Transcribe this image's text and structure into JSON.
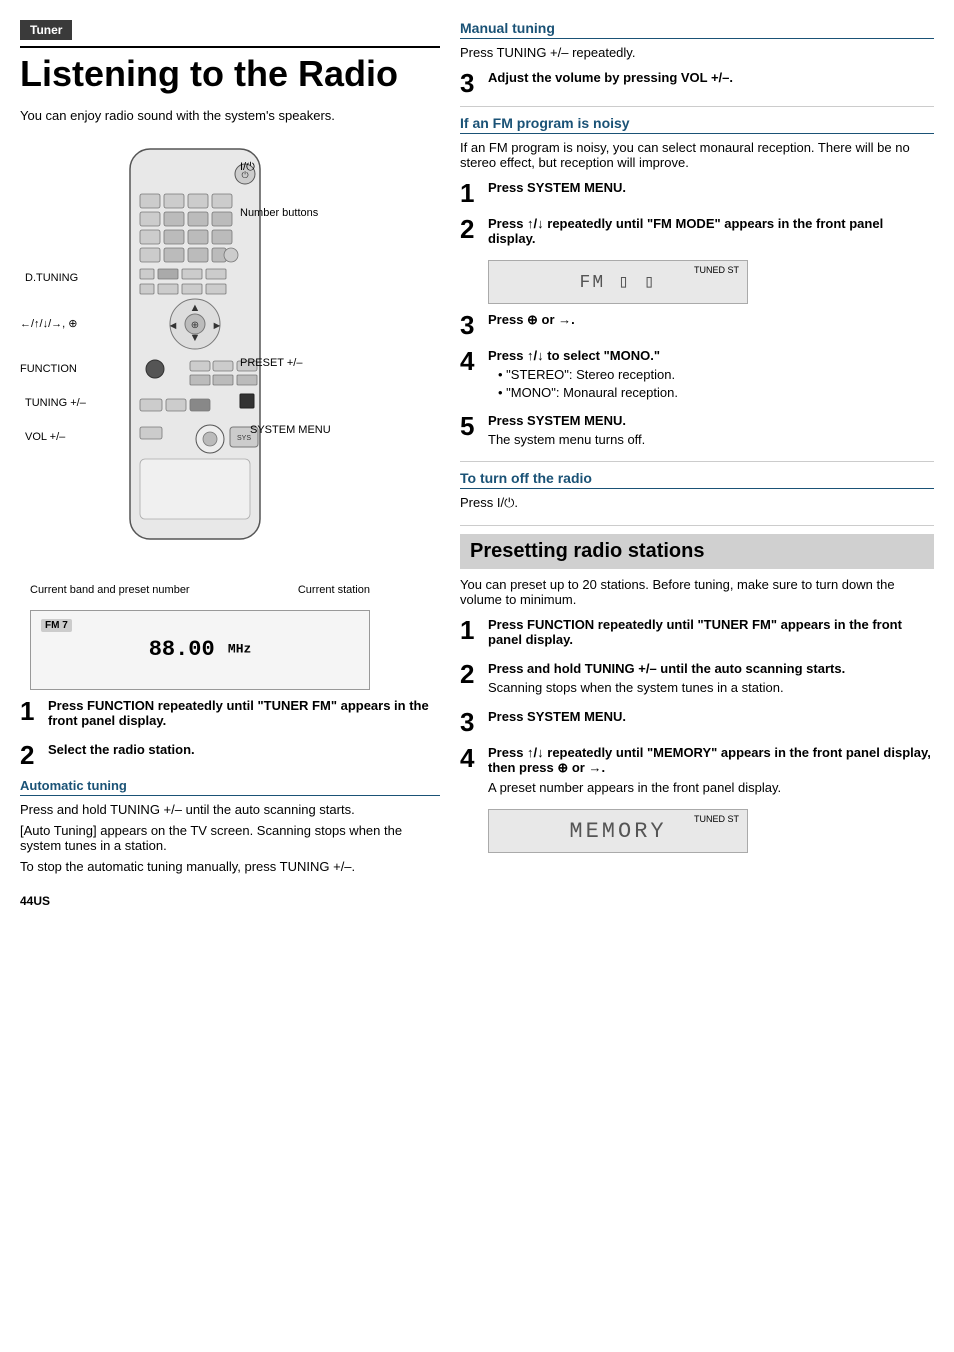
{
  "left": {
    "badge": "Tuner",
    "title": "Listening to the Radio",
    "intro": "You can enjoy radio sound with the system's speakers.",
    "labels": {
      "power": "I/⏻",
      "number_buttons": "Number buttons",
      "d_tuning": "D.TUNING",
      "arrows": "←/↑/↓/→, ⊕",
      "function": "FUNCTION",
      "preset": "PRESET +/–",
      "tuning": "TUNING +/–",
      "vol": "VOL +/–",
      "system_menu": "SYSTEM MENU",
      "current_station": "Current station",
      "current_band": "Current band and preset number"
    },
    "display": {
      "band": "FM 7",
      "freq": "88.00",
      "unit": "MHz"
    },
    "steps": [
      {
        "num": "1",
        "text": "Press FUNCTION repeatedly until \"TUNER FM\" appears in the front panel display."
      },
      {
        "num": "2",
        "text": "Select the radio station."
      }
    ],
    "auto_tuning": {
      "heading": "Automatic tuning",
      "lines": [
        "Press and hold TUNING +/– until the auto scanning starts.",
        "[Auto Tuning] appears on the TV screen. Scanning stops when the system tunes in a station.",
        "To stop the automatic tuning manually, press TUNING +/–."
      ]
    },
    "page_num": "44US"
  },
  "right": {
    "manual_tuning": {
      "heading": "Manual tuning",
      "text": "Press TUNING +/– repeatedly."
    },
    "step3": {
      "num": "3",
      "text": "Adjust the volume by pressing VOL +/–."
    },
    "if_fm_noisy": {
      "heading": "If an FM program is noisy",
      "intro": "If an FM program is noisy, you can select monaural reception. There will be no stereo effect, but reception will improve.",
      "steps": [
        {
          "num": "1",
          "text": "Press SYSTEM MENU."
        },
        {
          "num": "2",
          "text": "Press ↑/↓ repeatedly until \"FM MODE\" appears in the front panel display."
        },
        {
          "num": "3",
          "text": "Press ⊕ or →."
        },
        {
          "num": "4",
          "text": "Press ↑/↓ to select \"MONO.\""
        },
        {
          "num": "5",
          "text": "Press SYSTEM MENU."
        }
      ],
      "bullets": [
        "\"STEREO\": Stereo reception.",
        "\"MONO\": Monaural reception."
      ],
      "step5_note": "The system menu turns off."
    },
    "to_turn_off": {
      "heading": "To turn off the radio",
      "text": "Press I/⏻."
    },
    "presetting": {
      "box_title": "Presetting radio stations",
      "intro": "You can preset up to 20 stations. Before tuning, make sure to turn down the volume to minimum.",
      "steps": [
        {
          "num": "1",
          "text": "Press FUNCTION repeatedly until \"TUNER FM\" appears in the front panel display."
        },
        {
          "num": "2",
          "text": "Press and hold TUNING +/– until the auto scanning starts.",
          "note": "Scanning stops when the system tunes in a station."
        },
        {
          "num": "3",
          "text": "Press SYSTEM MENU."
        },
        {
          "num": "4",
          "text": "Press ↑/↓ repeatedly until \"MEMORY\" appears in the front panel display, then press ⊕ or →.",
          "note": "A preset number appears in the front panel display."
        }
      ]
    }
  }
}
